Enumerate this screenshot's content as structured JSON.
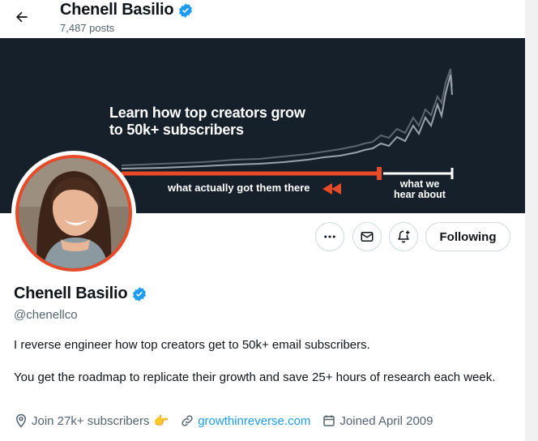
{
  "header": {
    "back_icon": "arrow-left-icon",
    "name": "Chenell Basilio",
    "posts_count": "7,487 posts",
    "verified_icon": "verified-badge-icon"
  },
  "banner": {
    "title_line1": "Learn how top creators grow",
    "title_line2": "to 50k+ subscribers",
    "actual_label": "what actually got them there",
    "hear_line1": "what we",
    "hear_line2": "hear about",
    "accent_color": "#e84a27",
    "bg_color": "#16202b"
  },
  "actions": {
    "more_icon": "more-icon",
    "message_icon": "mail-icon",
    "notify_icon": "bell-plus-icon",
    "following_label": "Following"
  },
  "profile": {
    "name": "Chenell Basilio",
    "handle": "@chenellco",
    "bio_line1": "I reverse engineer how top creators get to 50k+ email subscribers.",
    "bio_line2": "You get the roadmap to replicate their growth and save 25+ hours of research each week.",
    "location": "Join 27k+ subscribers",
    "location_emoji": "👉",
    "website": "growthinreverse.com",
    "joined": "Joined April 2009",
    "verified_color": "#1d9bf0"
  }
}
